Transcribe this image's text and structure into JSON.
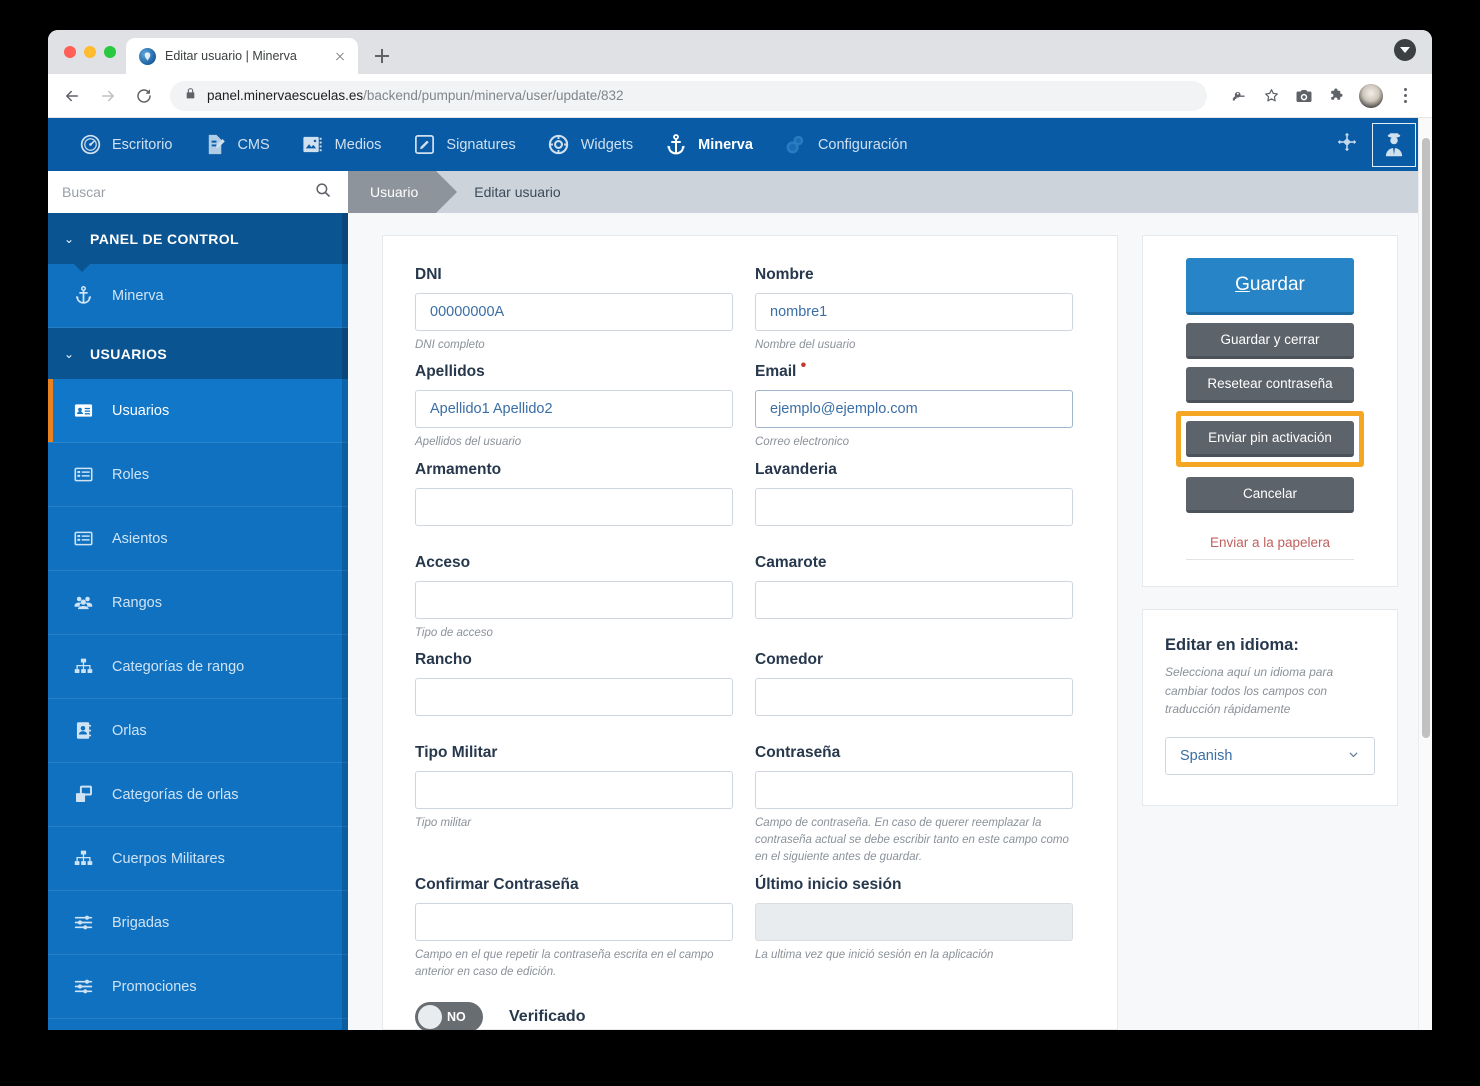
{
  "browser": {
    "tab": {
      "title": "Editar usuario | Minerva",
      "favicon": "minerva-favicon"
    },
    "new_tab_label": "+",
    "url": {
      "domain": "panel.minervaescuelas.es",
      "path": "/backend/pumpun/minerva/user/update/832"
    },
    "icons": {
      "back": "←",
      "forward": "→",
      "reload": "⟳",
      "lock": "lock-icon",
      "password_key": "key-icon",
      "bookmark": "star-icon",
      "screenshot": "camera-icon",
      "extensions": "puzzle-icon",
      "profile": "avatar-icon",
      "menu": "kebab-menu-icon",
      "tab_list": "tab-list-chevron-icon"
    }
  },
  "topnav": {
    "items": [
      {
        "label": "Escritorio",
        "icon": "dashboard-gauge-icon",
        "active": false
      },
      {
        "label": "CMS",
        "icon": "document-pencil-icon",
        "active": false
      },
      {
        "label": "Medios",
        "icon": "media-image-icon",
        "active": false
      },
      {
        "label": "Signatures",
        "icon": "signature-pencil-icon",
        "active": false
      },
      {
        "label": "Widgets",
        "icon": "lifebuoy-icon",
        "active": false
      },
      {
        "label": "Minerva",
        "icon": "anchor-icon",
        "active": true
      },
      {
        "label": "Configuración",
        "icon": "gears-icon",
        "active": false
      }
    ],
    "right": {
      "move_icon": "move-arrows-icon",
      "user_icon": "officer-avatar-icon"
    },
    "background": "#0a5ba5"
  },
  "sidebar": {
    "search": {
      "placeholder": "Buscar",
      "value": "",
      "icon": "search-icon"
    },
    "groups": [
      {
        "title": "PANEL DE CONTROL",
        "caret": "⌄",
        "items": [
          {
            "label": "Minerva",
            "icon": "anchor-icon",
            "selected": false
          }
        ]
      },
      {
        "title": "USUARIOS",
        "caret": "⌄",
        "items": [
          {
            "label": "Usuarios",
            "icon": "id-card-icon",
            "selected": true
          },
          {
            "label": "Roles",
            "icon": "list-icon",
            "selected": false
          },
          {
            "label": "Asientos",
            "icon": "list-icon",
            "selected": false
          },
          {
            "label": "Rangos",
            "icon": "users-group-icon",
            "selected": false
          },
          {
            "label": "Categorías de rango",
            "icon": "sitemap-icon",
            "selected": false
          },
          {
            "label": "Orlas",
            "icon": "contact-book-icon",
            "selected": false
          },
          {
            "label": "Categorías de orlas",
            "icon": "clone-windows-icon",
            "selected": false
          },
          {
            "label": "Cuerpos Militares",
            "icon": "sitemap-icon",
            "selected": false
          },
          {
            "label": "Brigadas",
            "icon": "sliders-icon",
            "selected": false
          },
          {
            "label": "Promociones",
            "icon": "sliders-icon",
            "selected": false
          }
        ]
      }
    ],
    "accent_selected": "#e8821e"
  },
  "breadcrumb": {
    "first": "Usuario",
    "current": "Editar usuario"
  },
  "form": {
    "fields": [
      {
        "label": "DNI",
        "value": "00000000A",
        "help": "DNI completo",
        "required": false,
        "readonly": false,
        "focused": false
      },
      {
        "label": "Nombre",
        "value": "nombre1",
        "help": "Nombre del usuario",
        "required": false,
        "readonly": false,
        "focused": false
      },
      {
        "label": "Apellidos",
        "value": "Apellido1 Apellido2",
        "help": "Apellidos del usuario",
        "required": false,
        "readonly": false,
        "focused": false
      },
      {
        "label": "Email",
        "value": "ejemplo@ejemplo.com",
        "help": "Correo electronico",
        "required": true,
        "readonly": false,
        "focused": true
      },
      {
        "label": "Armamento",
        "value": "",
        "help": "",
        "required": false,
        "readonly": false,
        "focused": false
      },
      {
        "label": "Lavanderia",
        "value": "",
        "help": "",
        "required": false,
        "readonly": false,
        "focused": false
      },
      {
        "label": "Acceso",
        "value": "",
        "help": "Tipo de acceso",
        "required": false,
        "readonly": false,
        "focused": false
      },
      {
        "label": "Camarote",
        "value": "",
        "help": "",
        "required": false,
        "readonly": false,
        "focused": false
      },
      {
        "label": "Rancho",
        "value": "",
        "help": "",
        "required": false,
        "readonly": false,
        "focused": false
      },
      {
        "label": "Comedor",
        "value": "",
        "help": "",
        "required": false,
        "readonly": false,
        "focused": false
      },
      {
        "label": "Tipo Militar",
        "value": "",
        "help": "Tipo militar",
        "required": false,
        "readonly": false,
        "focused": false
      },
      {
        "label": "Contraseña",
        "value": "",
        "help": "Campo de contraseña. En caso de querer reemplazar la contraseña actual se debe escribir tanto en este campo como en el siguiente antes de guardar.",
        "required": false,
        "readonly": false,
        "focused": false
      },
      {
        "label": "Confirmar Contraseña",
        "value": "",
        "help": "Campo en el que repetir la contraseña escrita en el campo anterior en caso de edición.",
        "required": false,
        "readonly": false,
        "focused": false
      },
      {
        "label": "Último inicio sesión",
        "value": "",
        "help": "La ultima vez que inició sesión en la aplicación",
        "required": false,
        "readonly": true,
        "focused": false
      }
    ],
    "toggle": {
      "state": "NO",
      "label": "Verificado",
      "on": false
    }
  },
  "actions": {
    "save": "Guardar",
    "save_accesskey": "G",
    "save_and_close": "Guardar y cerrar",
    "reset_password": "Resetear contraseña",
    "send_activation_pin": "Enviar pin activación",
    "cancel": "Cancelar",
    "trash": "Enviar a la papelera",
    "highlight_color": "#f5a623",
    "primary_color": "#2784c6",
    "secondary_color": "#5d636b",
    "trash_color": "#c0615f"
  },
  "language_panel": {
    "title": "Editar en idioma:",
    "description": "Selecciona aquí un idioma para cambiar todos los campos con traducción rápidamente",
    "selected": "Spanish",
    "chevron": "chevron-down-icon"
  }
}
